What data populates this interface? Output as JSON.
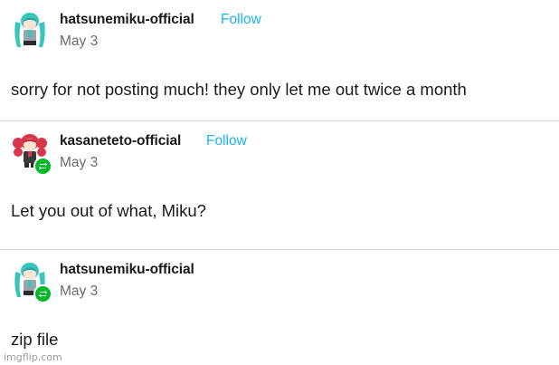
{
  "posts": [
    {
      "username": "hatsunemiku-official",
      "follow_label": "Follow",
      "date": "May 3",
      "text": "sorry for not posting much! they only let me out twice a month",
      "avatar_icon": "miku-avatar-icon"
    },
    {
      "username": "kasaneteto-official",
      "follow_label": "Follow",
      "date": "May 3",
      "text": "Let you out of what, Miku?",
      "avatar_icon": "teto-avatar-icon",
      "badge_icon": "reblog-icon"
    },
    {
      "username": "hatsunemiku-official",
      "date": "May 3",
      "text": "zip file",
      "avatar_icon": "miku-avatar-icon",
      "badge_icon": "reblog-icon"
    }
  ],
  "watermark": "imgflip.com",
  "colors": {
    "follow": "#1ab2f1",
    "reblog_badge": "#00b929",
    "divider": "#d6d6d6"
  }
}
